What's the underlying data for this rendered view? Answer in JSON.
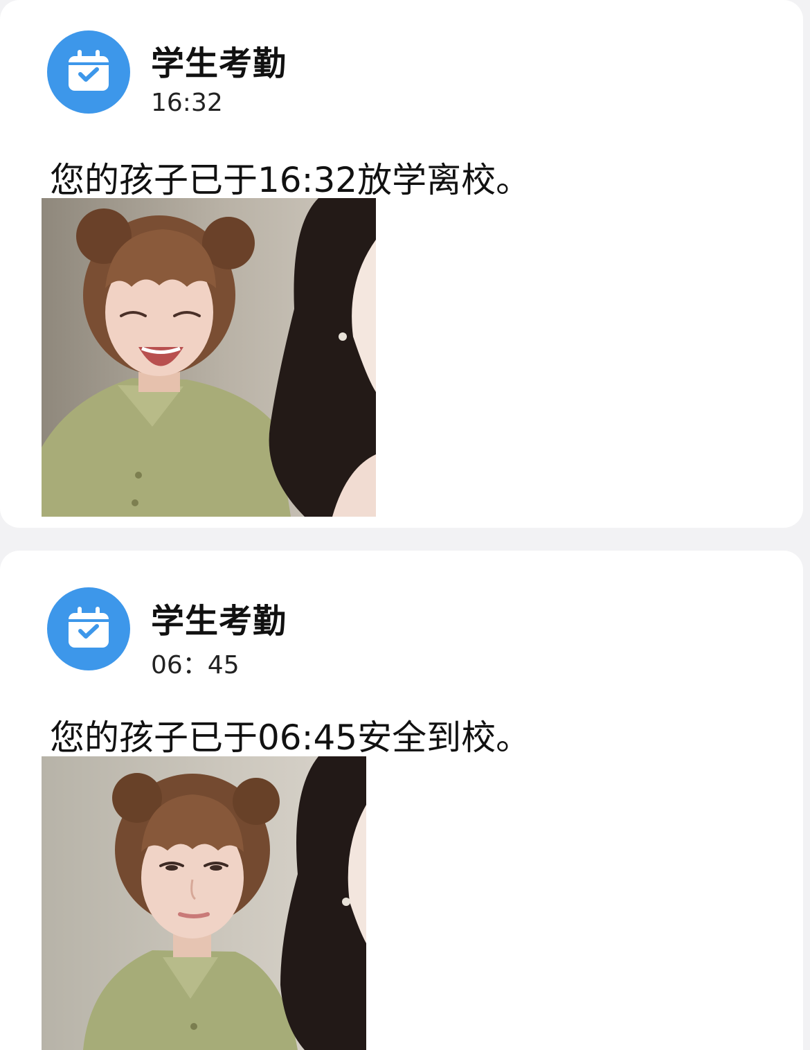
{
  "accent_color": "#3d97ea",
  "notifications": [
    {
      "icon": "calendar-check-icon",
      "sender": "学生考勤",
      "time": "16:32",
      "message": "您的孩子已于16:32放学离校。",
      "photo_expression": "laughing"
    },
    {
      "icon": "calendar-check-icon",
      "sender": "学生考勤",
      "time": "06：45",
      "message": "您的孩子已于06:45安全到校。",
      "photo_expression": "tired"
    }
  ]
}
